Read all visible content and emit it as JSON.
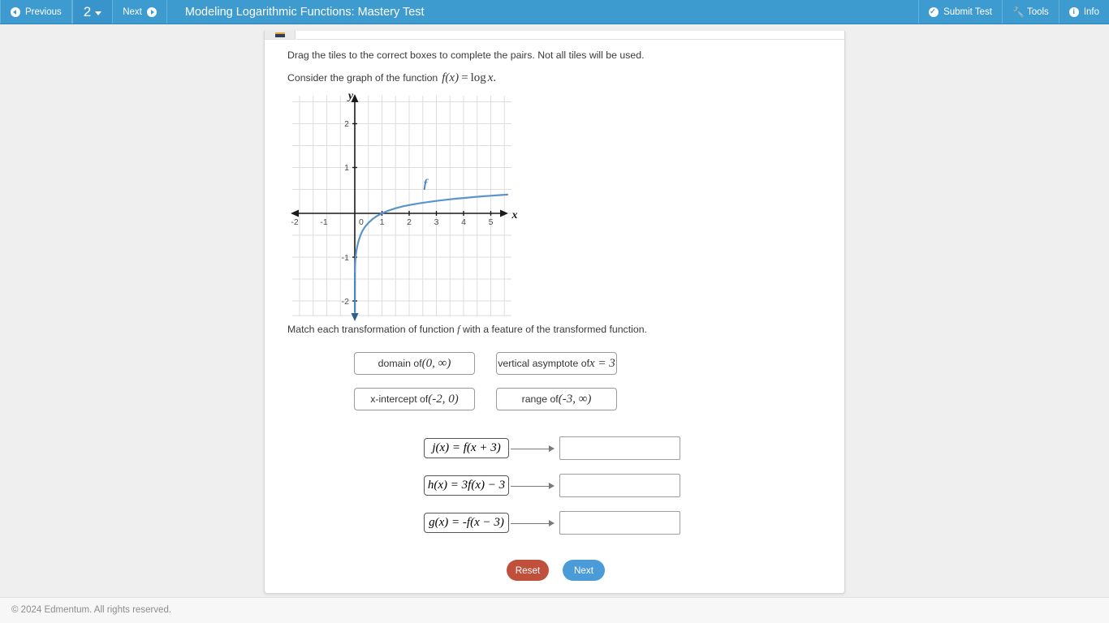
{
  "topbar": {
    "previous_label": "Previous",
    "question_number": "2",
    "next_label": "Next",
    "title": "Modeling Logarithmic Functions: Mastery Test",
    "submit_label": "Submit Test",
    "tools_label": "Tools",
    "info_label": "Info",
    "background_color": "#3d9bd0"
  },
  "question": {
    "instruction": "Drag the tiles to the correct boxes to complete the pairs. Not all tiles will be used.",
    "consider_prefix": "Consider the graph of the function",
    "consider_fx": "f(x)",
    "consider_eq": "=",
    "consider_log": "log",
    "consider_var": "x",
    "consider_period": ".",
    "match_prefix": "Match each transformation of function",
    "match_fn": "f",
    "match_suffix": "with a feature of the transformed function."
  },
  "chart_data": {
    "type": "line",
    "title": "",
    "xlabel": "x",
    "ylabel": "y",
    "xlim": [
      -2.35,
      5.85
    ],
    "ylim": [
      -2.45,
      2.45
    ],
    "xticks": [
      "-2",
      "-1",
      "0",
      "1",
      "2",
      "3",
      "4",
      "5"
    ],
    "xtick_values": [
      -2,
      -1,
      0,
      1,
      2,
      3,
      4,
      5
    ],
    "yticks": [
      "2",
      "1",
      "-1",
      "-2"
    ],
    "ytick_values": [
      2,
      1,
      -1,
      -2
    ],
    "grid": true,
    "grid_step": 0.5,
    "series": [
      {
        "name": "f",
        "label": "f",
        "color": "#5b94cb",
        "function": "log10(x)",
        "points": [
          [
            0.006,
            -2.2
          ],
          [
            0.01,
            -2.0
          ],
          [
            0.02,
            -1.7
          ],
          [
            0.04,
            -1.4
          ],
          [
            0.06,
            -1.22
          ],
          [
            0.1,
            -1.0
          ],
          [
            0.15,
            -0.82
          ],
          [
            0.2,
            -0.7
          ],
          [
            0.3,
            -0.52
          ],
          [
            0.4,
            -0.4
          ],
          [
            0.5,
            -0.3
          ],
          [
            0.6,
            -0.22
          ],
          [
            0.8,
            -0.1
          ],
          [
            1.0,
            0.0
          ],
          [
            1.5,
            0.18
          ],
          [
            2.0,
            0.3
          ],
          [
            2.5,
            0.4
          ],
          [
            3.0,
            0.48
          ],
          [
            3.5,
            0.54
          ],
          [
            4.0,
            0.6
          ],
          [
            4.5,
            0.65
          ],
          [
            5.0,
            0.7
          ],
          [
            5.6,
            0.75
          ]
        ]
      }
    ],
    "annotations": [
      {
        "text": "f",
        "x": 2.6,
        "y": 0.75
      }
    ]
  },
  "tiles": [
    {
      "id": "tile-domain",
      "prefix": "domain of ",
      "math": "(0, ∞)"
    },
    {
      "id": "tile-va",
      "prefix": "vertical asymptote of ",
      "math": "x = 3"
    },
    {
      "id": "tile-xint",
      "prefix": "x-intercept of ",
      "math": "(-2, 0)"
    },
    {
      "id": "tile-range",
      "prefix": "range of ",
      "math": "(-3, ∞)"
    }
  ],
  "matches": [
    {
      "id": "match-j",
      "equation": "j(x) = f(x + 3)",
      "dropzone_value": ""
    },
    {
      "id": "match-h",
      "equation": "h(x) = 3f(x) − 3",
      "dropzone_value": ""
    },
    {
      "id": "match-g",
      "equation": "g(x) = -f(x − 3)",
      "dropzone_value": ""
    }
  ],
  "buttons": {
    "reset_label": "Reset",
    "reset_color": "#c0503c",
    "next_label": "Next",
    "next_color": "#4a9bd8"
  },
  "footer": {
    "copyright": "© 2024 Edmentum. All rights reserved."
  }
}
